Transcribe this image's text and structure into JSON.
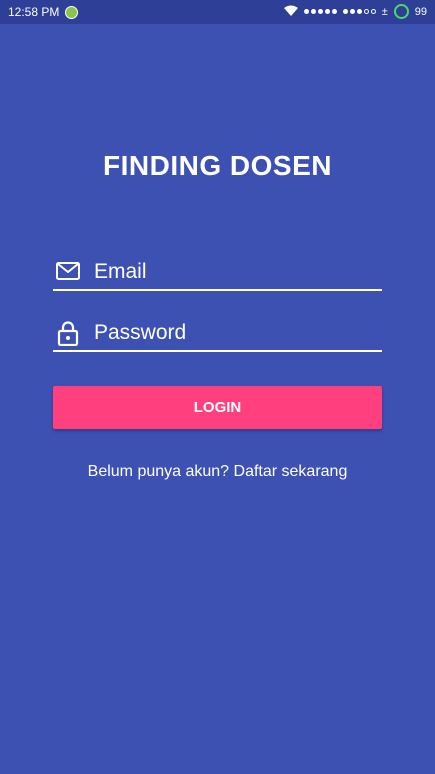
{
  "status_bar": {
    "time": "12:58 PM",
    "battery": "99",
    "data_indicator": "±"
  },
  "app": {
    "title": "FINDING DOSEN"
  },
  "form": {
    "email_placeholder": "Email",
    "password_placeholder": "Password",
    "login_label": "LOGIN",
    "register_text": "Belum punya akun? Daftar sekarang"
  },
  "colors": {
    "background": "#3D51B3",
    "status_bar": "#2E3F98",
    "accent": "#FF3F7E",
    "text": "#FFFFFF"
  },
  "icons": {
    "email": "mail-icon",
    "password": "lock-icon"
  }
}
